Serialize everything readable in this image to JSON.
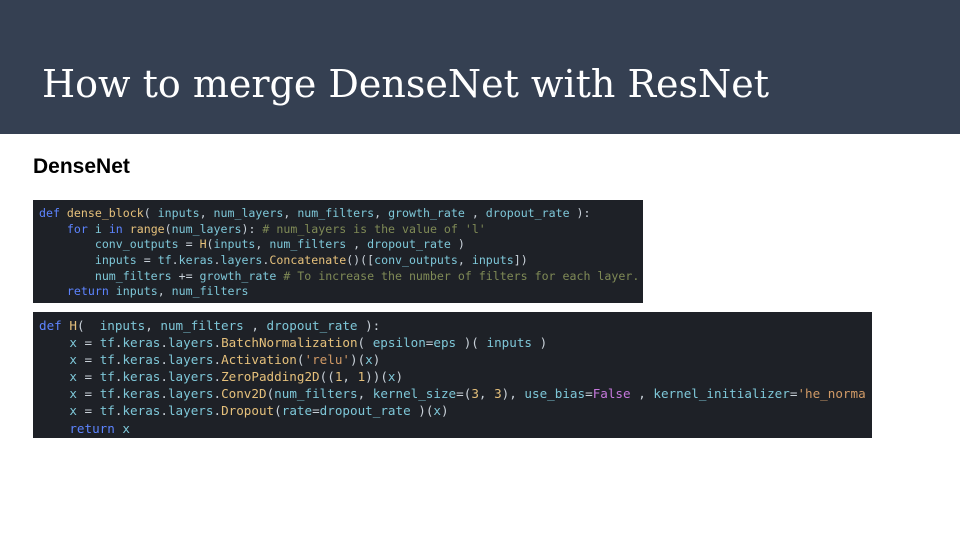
{
  "slide": {
    "title": "How to merge DenseNet with ResNet",
    "subtitle": "DenseNet"
  },
  "colors": {
    "header_bg": "#354052",
    "code_bg": "#1e2127",
    "keyword": "#5d84ff",
    "function": "#e5c07b",
    "variable": "#7ec7d8",
    "plain": "#c9d1d9",
    "comment": "#7f8a56",
    "string": "#d19a66",
    "number": "#e5c07b",
    "constant": "#c678dd"
  },
  "code_blocks": [
    {
      "lines": [
        [
          [
            "kw",
            "def "
          ],
          [
            "fn",
            "dense_block"
          ],
          [
            "pl",
            "( "
          ],
          [
            "var",
            "inputs"
          ],
          [
            "pl",
            ", "
          ],
          [
            "var",
            "num_layers"
          ],
          [
            "pl",
            ", "
          ],
          [
            "var",
            "num_filters"
          ],
          [
            "pl",
            ", "
          ],
          [
            "var",
            "growth_rate"
          ],
          [
            "pl",
            " , "
          ],
          [
            "var",
            "dropout_rate"
          ],
          [
            "pl",
            " ):"
          ]
        ],
        [
          [
            "pl",
            "    "
          ],
          [
            "kw",
            "for "
          ],
          [
            "var",
            "i "
          ],
          [
            "kw",
            "in "
          ],
          [
            "fn",
            "range"
          ],
          [
            "pl",
            "("
          ],
          [
            "var",
            "num_layers"
          ],
          [
            "pl",
            "): "
          ],
          [
            "cm",
            "# num_layers is the value of 'l'"
          ]
        ],
        [
          [
            "pl",
            "        "
          ],
          [
            "var",
            "conv_outputs"
          ],
          [
            "pl",
            " = "
          ],
          [
            "fn",
            "H"
          ],
          [
            "pl",
            "("
          ],
          [
            "var",
            "inputs"
          ],
          [
            "pl",
            ", "
          ],
          [
            "var",
            "num_filters"
          ],
          [
            "pl",
            " , "
          ],
          [
            "var",
            "dropout_rate"
          ],
          [
            "pl",
            " )"
          ]
        ],
        [
          [
            "pl",
            "        "
          ],
          [
            "var",
            "inputs"
          ],
          [
            "pl",
            " = "
          ],
          [
            "var",
            "tf"
          ],
          [
            "pl",
            "."
          ],
          [
            "var",
            "keras"
          ],
          [
            "pl",
            "."
          ],
          [
            "var",
            "layers"
          ],
          [
            "pl",
            "."
          ],
          [
            "fn",
            "Concatenate"
          ],
          [
            "pl",
            "()(["
          ],
          [
            "var",
            "conv_outputs"
          ],
          [
            "pl",
            ", "
          ],
          [
            "var",
            "inputs"
          ],
          [
            "pl",
            "])"
          ]
        ],
        [
          [
            "pl",
            "        "
          ],
          [
            "var",
            "num_filters"
          ],
          [
            "pl",
            " += "
          ],
          [
            "var",
            "growth_rate"
          ],
          [
            "pl",
            " "
          ],
          [
            "cm",
            "# To increase the number of filters for each layer."
          ]
        ],
        [
          [
            "pl",
            "    "
          ],
          [
            "kw",
            "return "
          ],
          [
            "var",
            "inputs"
          ],
          [
            "pl",
            ", "
          ],
          [
            "var",
            "num_filters"
          ]
        ]
      ]
    },
    {
      "lines": [
        [
          [
            "kw",
            "def "
          ],
          [
            "fn",
            "H"
          ],
          [
            "pl",
            "(  "
          ],
          [
            "var",
            "inputs"
          ],
          [
            "pl",
            ", "
          ],
          [
            "var",
            "num_filters"
          ],
          [
            "pl",
            " , "
          ],
          [
            "var",
            "dropout_rate"
          ],
          [
            "pl",
            " ):"
          ]
        ],
        [
          [
            "pl",
            "    "
          ],
          [
            "var",
            "x"
          ],
          [
            "pl",
            " = "
          ],
          [
            "var",
            "tf"
          ],
          [
            "pl",
            "."
          ],
          [
            "var",
            "keras"
          ],
          [
            "pl",
            "."
          ],
          [
            "var",
            "layers"
          ],
          [
            "pl",
            "."
          ],
          [
            "fn",
            "BatchNormalization"
          ],
          [
            "pl",
            "( "
          ],
          [
            "var",
            "epsilon"
          ],
          [
            "pl",
            "="
          ],
          [
            "var",
            "eps"
          ],
          [
            "pl",
            " )( "
          ],
          [
            "var",
            "inputs"
          ],
          [
            "pl",
            " )"
          ]
        ],
        [
          [
            "pl",
            "    "
          ],
          [
            "var",
            "x"
          ],
          [
            "pl",
            " = "
          ],
          [
            "var",
            "tf"
          ],
          [
            "pl",
            "."
          ],
          [
            "var",
            "keras"
          ],
          [
            "pl",
            "."
          ],
          [
            "var",
            "layers"
          ],
          [
            "pl",
            "."
          ],
          [
            "fn",
            "Activation"
          ],
          [
            "pl",
            "("
          ],
          [
            "str",
            "'relu'"
          ],
          [
            "pl",
            ")("
          ],
          [
            "var",
            "x"
          ],
          [
            "pl",
            ")"
          ]
        ],
        [
          [
            "pl",
            "    "
          ],
          [
            "var",
            "x"
          ],
          [
            "pl",
            " = "
          ],
          [
            "var",
            "tf"
          ],
          [
            "pl",
            "."
          ],
          [
            "var",
            "keras"
          ],
          [
            "pl",
            "."
          ],
          [
            "var",
            "layers"
          ],
          [
            "pl",
            "."
          ],
          [
            "fn",
            "ZeroPadding2D"
          ],
          [
            "pl",
            "(("
          ],
          [
            "num",
            "1"
          ],
          [
            "pl",
            ", "
          ],
          [
            "num",
            "1"
          ],
          [
            "pl",
            "))("
          ],
          [
            "var",
            "x"
          ],
          [
            "pl",
            ")"
          ]
        ],
        [
          [
            "pl",
            "    "
          ],
          [
            "var",
            "x"
          ],
          [
            "pl",
            " = "
          ],
          [
            "var",
            "tf"
          ],
          [
            "pl",
            "."
          ],
          [
            "var",
            "keras"
          ],
          [
            "pl",
            "."
          ],
          [
            "var",
            "layers"
          ],
          [
            "pl",
            "."
          ],
          [
            "fn",
            "Conv2D"
          ],
          [
            "pl",
            "("
          ],
          [
            "var",
            "num_filters"
          ],
          [
            "pl",
            ", "
          ],
          [
            "var",
            "kernel_size"
          ],
          [
            "pl",
            "=("
          ],
          [
            "num",
            "3"
          ],
          [
            "pl",
            ", "
          ],
          [
            "num",
            "3"
          ],
          [
            "pl",
            "), "
          ],
          [
            "var",
            "use_bias"
          ],
          [
            "pl",
            "="
          ],
          [
            "const",
            "False"
          ],
          [
            "pl",
            " , "
          ],
          [
            "var",
            "kernel_initializer"
          ],
          [
            "pl",
            "="
          ],
          [
            "str",
            "'he_norma"
          ]
        ],
        [
          [
            "pl",
            "    "
          ],
          [
            "var",
            "x"
          ],
          [
            "pl",
            " = "
          ],
          [
            "var",
            "tf"
          ],
          [
            "pl",
            "."
          ],
          [
            "var",
            "keras"
          ],
          [
            "pl",
            "."
          ],
          [
            "var",
            "layers"
          ],
          [
            "pl",
            "."
          ],
          [
            "fn",
            "Dropout"
          ],
          [
            "pl",
            "("
          ],
          [
            "var",
            "rate"
          ],
          [
            "pl",
            "="
          ],
          [
            "var",
            "dropout_rate"
          ],
          [
            "pl",
            " )("
          ],
          [
            "var",
            "x"
          ],
          [
            "pl",
            ")"
          ]
        ],
        [
          [
            "pl",
            "    "
          ],
          [
            "kw",
            "return "
          ],
          [
            "var",
            "x"
          ]
        ]
      ]
    }
  ]
}
